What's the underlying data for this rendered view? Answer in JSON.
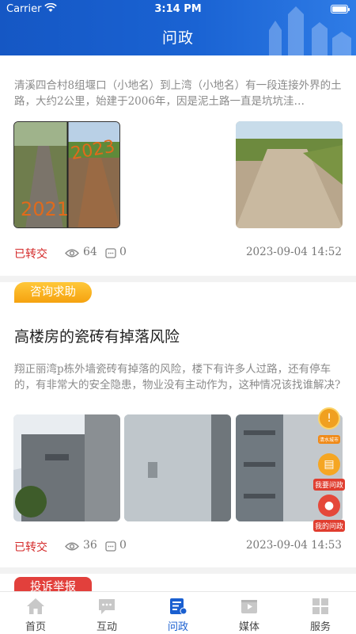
{
  "status_bar": {
    "carrier": "Carrier",
    "time": "3:14 PM"
  },
  "header": {
    "title": "问政"
  },
  "posts": [
    {
      "description": "清溪四合村8组堰口（小地名）到上湾（小地名）有一段连接外界的土路，大约2公里，始建于2006年，因是泥土路一直是坑坑洼…",
      "status": "已转交",
      "views": "64",
      "comments": "0",
      "date": "2023-09-04  14:52",
      "photo_labels": [
        "2021",
        "2023"
      ]
    },
    {
      "category": "咨询求助",
      "title": "高楼房的瓷砖有掉落风险",
      "description": "翔正丽湾p栋外墙瓷砖有掉落的风险，楼下有许多人过路，还有停车的，有非常大的安全隐患，物业没有主动作为，这种情况该找谁解决?",
      "status": "已转交",
      "views": "36",
      "comments": "0",
      "date": "2023-09-04  14:53"
    },
    {
      "category": "投诉举报"
    }
  ],
  "floating": {
    "notice_label": "清水城市",
    "ask_label": "我要问政",
    "mine_label": "我的问政"
  },
  "tabs": [
    {
      "label": "首页",
      "icon": "home-icon"
    },
    {
      "label": "互动",
      "icon": "chat-icon"
    },
    {
      "label": "问政",
      "icon": "inquiry-icon",
      "active": true
    },
    {
      "label": "媒体",
      "icon": "media-icon"
    },
    {
      "label": "服务",
      "icon": "service-icon"
    }
  ],
  "colors": {
    "header": "#1a5fd0",
    "accent": "#1a5fd0",
    "status": "#d42a2a",
    "consult_badge": "#f5a20f",
    "complaint_badge": "#e2403c"
  }
}
